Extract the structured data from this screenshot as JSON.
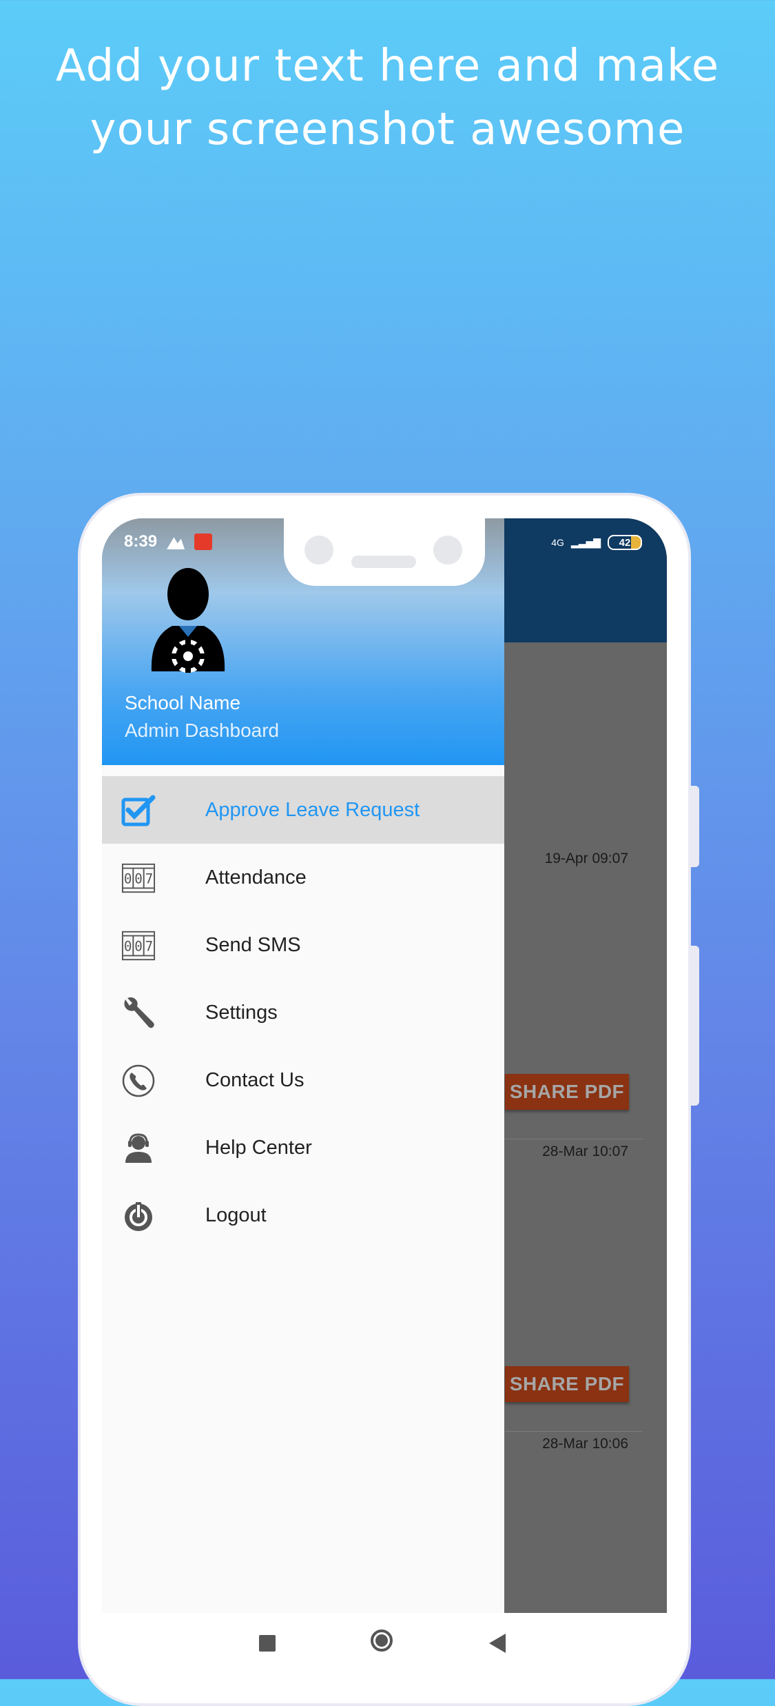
{
  "headline": {
    "line1": "Add your text here and make",
    "line2": "your screenshot awesome"
  },
  "status_bar": {
    "time": "8:39",
    "network": "4G",
    "battery": "42"
  },
  "drawer": {
    "school_name": "School Name",
    "role": "Admin Dashboard",
    "menu": [
      {
        "label": "Approve Leave Request",
        "icon": "checkbox-icon",
        "active": true
      },
      {
        "label": "Attendance",
        "icon": "counter-icon"
      },
      {
        "label": "Send SMS",
        "icon": "counter-icon"
      },
      {
        "label": "Settings",
        "icon": "wrench-icon"
      },
      {
        "label": "Contact Us",
        "icon": "phone-icon"
      },
      {
        "label": "Help Center",
        "icon": "support-agent-icon"
      },
      {
        "label": "Logout",
        "icon": "power-icon"
      }
    ]
  },
  "background_list": {
    "entries": [
      {
        "date": "19-Apr 09:07",
        "button": "SHARE PDF"
      },
      {
        "date": "28-Mar 10:07",
        "button": "SHARE PDF"
      },
      {
        "date": "28-Mar 10:06"
      }
    ]
  },
  "colors": {
    "accent": "#2196f3",
    "app_bar": "#0f3a62",
    "share_button": "#8a3212"
  }
}
